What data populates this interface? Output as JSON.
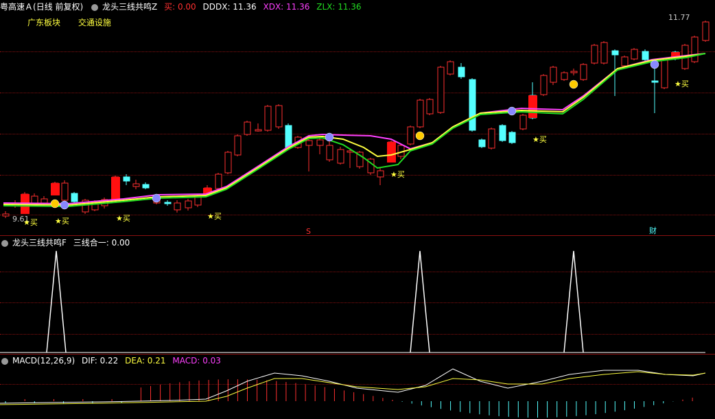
{
  "main_panel": {
    "stock_name": "粤高速Ａ",
    "period_label": "(日线 前复权)",
    "indicator_name": "龙头三线共鸣Z",
    "buy_label": "买: 0.00",
    "dddx_label": "DDDX: 11.36",
    "xdx_label": "XDX: 11.36",
    "zlx_label": "ZLX: 11.36",
    "sector_1": "广东板块",
    "sector_2": "交通设施",
    "high_price": "11.77",
    "low_price": "9.61",
    "buy_signal_text": "★买",
    "marker_s": "S",
    "marker_cai": "财",
    "colors": {
      "up": "#ff3030",
      "down": "#54ffff",
      "dddx": "#ff40ff",
      "xdx": "#ffff40",
      "zlx": "#22dd22"
    }
  },
  "signal_panel": {
    "indicator_name": "龙头三线共鸣F",
    "value_label": "三线合一: 0.00"
  },
  "macd_panel": {
    "indicator_name": "MACD(12,26,9)",
    "dif_label": "DIF: 0.22",
    "dea_label": "DEA: 0.21",
    "macd_label": "MACD: 0.03"
  }
}
